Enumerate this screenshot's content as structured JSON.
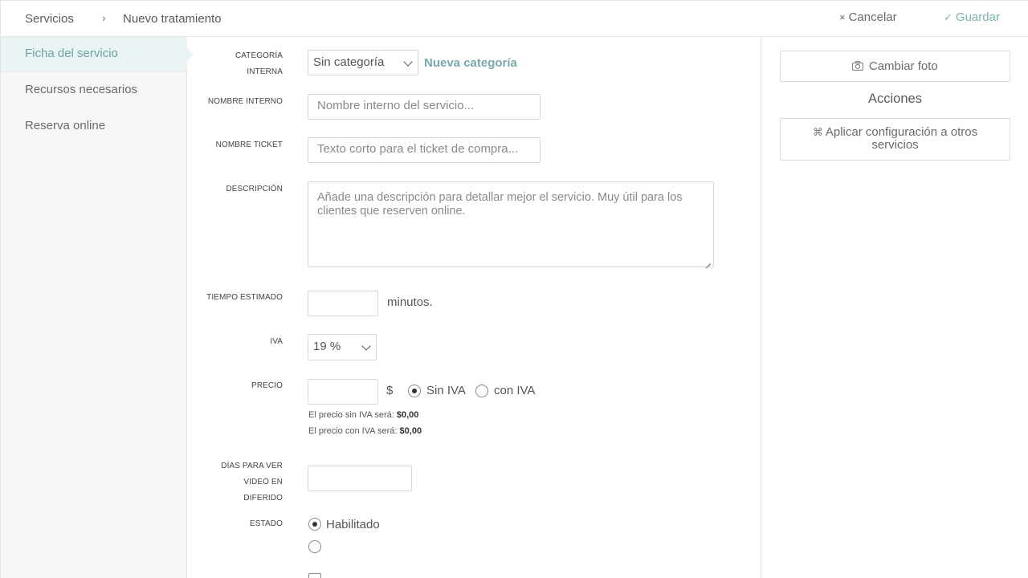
{
  "header": {
    "breadcrumb": [
      "Servicios",
      "Nuevo tratamiento"
    ],
    "separator": "›",
    "cancel_label": "Cancelar",
    "cancel_icon": "×",
    "save_label": "Guardar",
    "save_icon": "✓"
  },
  "sidebar": {
    "items": [
      {
        "label": "Ficha del servicio",
        "active": true
      },
      {
        "label": "Recursos necesarios",
        "active": false
      },
      {
        "label": "Reserva online",
        "active": false
      }
    ]
  },
  "form": {
    "categoria": {
      "label_line1": "CATEGORÍA",
      "label_line2": "INTERNA",
      "value": "Sin categoría",
      "new_link": "Nueva categoría"
    },
    "nombre_interno": {
      "label": "NOMBRE INTERNO",
      "placeholder": "Nombre interno del servicio..."
    },
    "nombre_ticket": {
      "label": "NOMBRE TICKET",
      "placeholder": "Texto corto para el ticket de compra..."
    },
    "descripcion": {
      "label": "DESCRIPCIÓN",
      "placeholder": "Añade una descripción para detallar mejor el servicio. Muy útil para los clientes que reserven online."
    },
    "tiempo": {
      "label": "TIEMPO ESTIMADO",
      "value": "",
      "unit": "minutos."
    },
    "iva": {
      "label": "IVA",
      "value": "19 %"
    },
    "precio": {
      "label": "PRECIO",
      "value": "",
      "currency": "$",
      "option_sin": "Sin IVA",
      "option_con": "con IVA",
      "selected": "Sin IVA",
      "hint_sin_prefix": "El precio sin IVA será:",
      "hint_sin_value": "$0,00",
      "hint_con_prefix": "El precio con IVA será:",
      "hint_con_value": "$0,00"
    },
    "dias": {
      "label_line1": "DÍAS PARA VER",
      "label_line2": "VIDEO EN",
      "label_line3": "DIFERIDO",
      "value": ""
    },
    "estado": {
      "label": "ESTADO",
      "option_1": "Habilitado",
      "selected": "Habilitado"
    }
  },
  "right": {
    "photo_button": "Cambiar foto",
    "actions_title": "Acciones",
    "apply_button_line1": "Aplicar configuración a otros",
    "apply_button_line2": "servicios",
    "accent_color": "#7fb0b2"
  }
}
